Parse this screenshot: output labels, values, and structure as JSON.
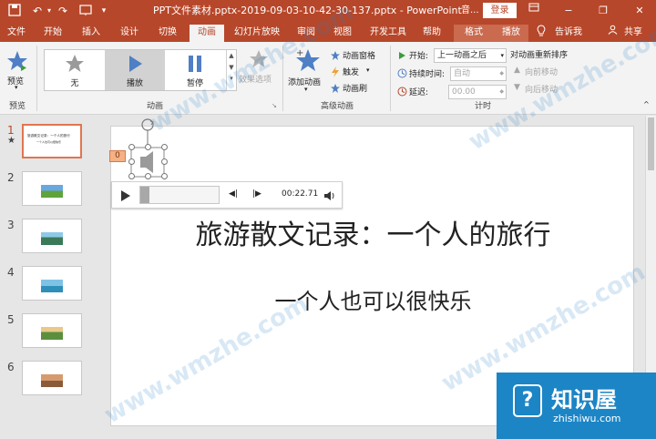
{
  "titlebar": {
    "title": "PPT文件素材.pptx-2019-09-03-10-42-30-137.pptx  -  PowerPoint",
    "right_text": "音...",
    "login": "登录",
    "minimize": "−",
    "restore": "❐",
    "close": "✕"
  },
  "tabs": [
    "文件",
    "开始",
    "插入",
    "设计",
    "切换",
    "动画",
    "幻灯片放映",
    "审阅",
    "视图",
    "开发工具",
    "帮助",
    "格式",
    "播放"
  ],
  "active_tab": "动画",
  "tell_me": "告诉我",
  "share": "共享",
  "ribbon": {
    "preview": {
      "label": "预览",
      "group": "预览"
    },
    "animation_gallery": {
      "items": [
        {
          "label": "无",
          "icon": "star-gray-icon"
        },
        {
          "label": "播放",
          "icon": "play-triangle-icon"
        },
        {
          "label": "暂停",
          "icon": "pause-bars-icon"
        }
      ],
      "selected": "播放",
      "group": "动画"
    },
    "effect_options": "效果选项",
    "advanced": {
      "add_animation": "添加动画",
      "animation_pane": "动画窗格",
      "trigger": "触发",
      "painter": "动画刷",
      "group": "高级动画"
    },
    "timing": {
      "start_label": "开始:",
      "start_value": "上一动画之后",
      "duration_label": "持续时间:",
      "duration_value": "自动",
      "delay_label": "延迟:",
      "delay_value": "00.00",
      "reorder_title": "对动画重新排序",
      "move_earlier": "向前移动",
      "move_later": "向后移动",
      "group": "计时"
    }
  },
  "thumbnails": {
    "numbers": [
      "1",
      "2",
      "3",
      "4",
      "5",
      "6"
    ],
    "star": "★",
    "title_snippet": "旅游散文记录：一个人的旅行",
    "sub_snippet": "一个人也可以很快乐"
  },
  "slide": {
    "title": "旅游散文记录：一个人的旅行",
    "subtitle": "一个人也可以很快乐",
    "anim_tag": "0",
    "player_time": "00:22.71"
  },
  "watermarks": [
    "www.wmzhe.com",
    "www.wmzhe.com",
    "www.wmzhe.com",
    "www.wmzhe.com"
  ],
  "brand": {
    "name": "知识屋",
    "domain": "zhishiwu.com"
  },
  "colors": {
    "accent": "#b7472a",
    "brand": "#1c85c6"
  }
}
